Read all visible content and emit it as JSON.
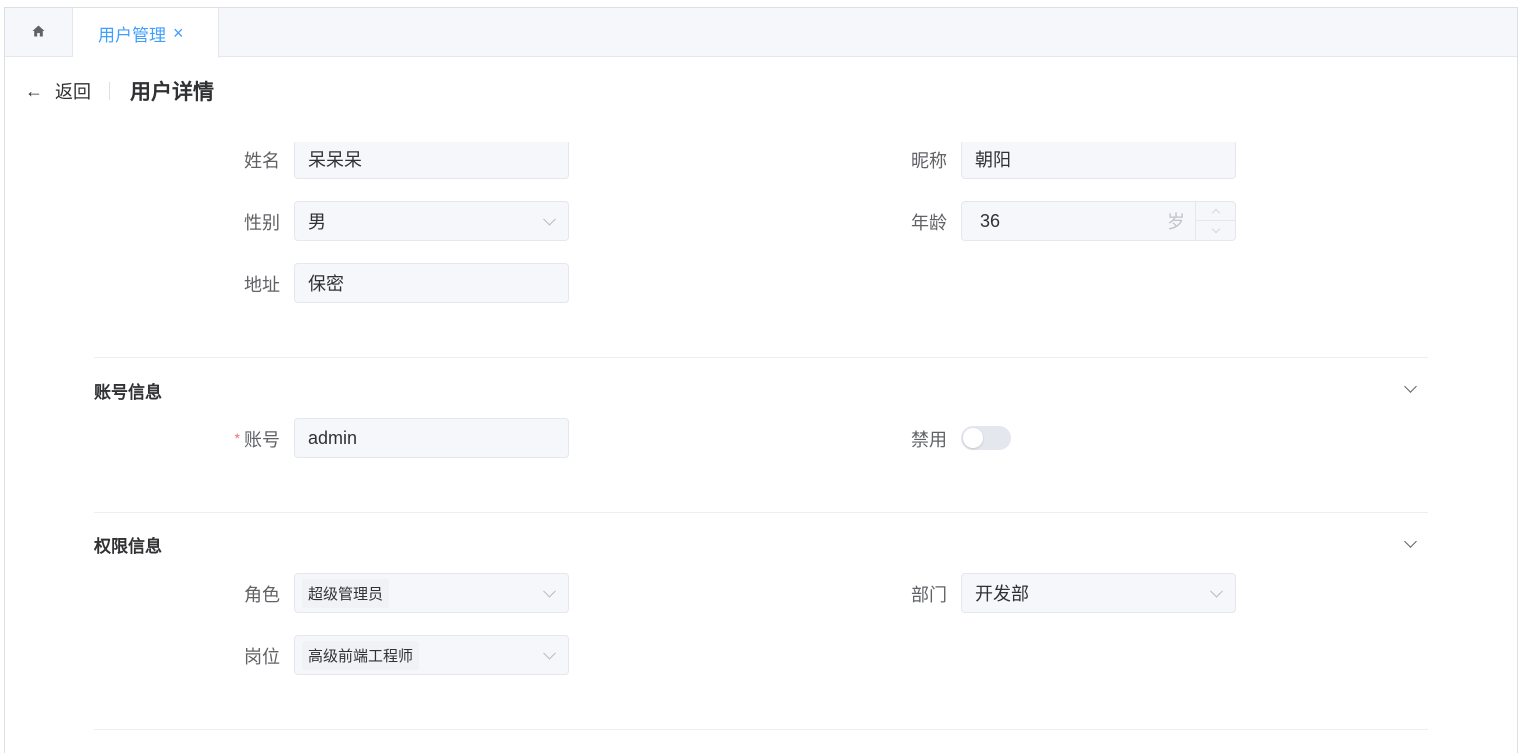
{
  "tabs": {
    "home_icon": "home-icon",
    "active_label": "用户管理",
    "close_glyph": "×"
  },
  "header": {
    "back_arrow": "←",
    "back_label": "返回",
    "title": "用户详情"
  },
  "basic": {
    "name_label": "姓名",
    "name_value": "呆呆呆",
    "nickname_label": "昵称",
    "nickname_value": "朝阳",
    "gender_label": "性别",
    "gender_value": "男",
    "age_label": "年龄",
    "age_value": "36",
    "age_suffix": "岁",
    "address_label": "地址",
    "address_value": "保密"
  },
  "account": {
    "section_title": "账号信息",
    "required_mark": "*",
    "account_label": "账号",
    "account_value": "admin",
    "disabled_label": "禁用",
    "disabled_on": false
  },
  "permission": {
    "section_title": "权限信息",
    "role_label": "角色",
    "role_value": "超级管理员",
    "dept_label": "部门",
    "dept_value": "开发部",
    "post_label": "岗位",
    "post_value": "高级前端工程师"
  },
  "colors": {
    "accent": "#409eff",
    "required": "#f56c6c"
  }
}
